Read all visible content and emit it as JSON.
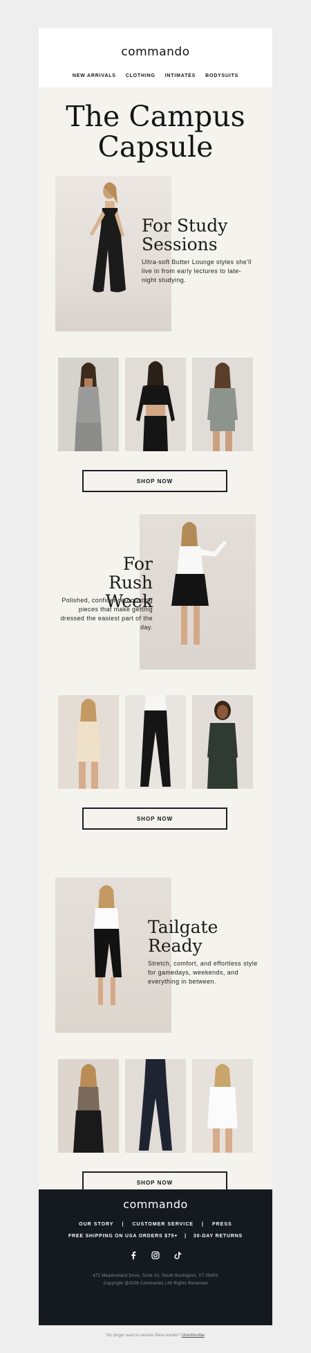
{
  "header": {
    "logo": "commando",
    "nav": [
      "NEW ARRIVALS",
      "CLOTHING",
      "INTIMATES",
      "BODYSUITS"
    ]
  },
  "hero_title_line1": "The Campus",
  "hero_title_line2": "Capsule",
  "sections": [
    {
      "title_line1": "For Study",
      "title_line2": "Sessions",
      "desc": "Ultra-soft Butter Lounge styles she'll live in from early lectures to late-night studying.",
      "button": "SHOP NOW"
    },
    {
      "title_line1": "For Rush",
      "title_line2": "Week",
      "desc": "Polished, confidence-boosting pieces that make getting dressed the easiest part of the day.",
      "button": "SHOP NOW"
    },
    {
      "title_line1": "Tailgate",
      "title_line2": "Ready",
      "desc": "Stretch, comfort, and effortless style for gamedays, weekends, and everything in between.",
      "button": "SHOP NOW"
    }
  ],
  "footer": {
    "logo": "commando",
    "links": [
      "OUR STORY",
      "|",
      "CUSTOMER SERVICE",
      "|",
      "PRESS"
    ],
    "shipping": [
      "FREE SHIPPING ON USA ORDERS $75+",
      "|",
      "30-DAY RETURNS"
    ],
    "social_icons": [
      "facebook-icon",
      "instagram-icon",
      "tiktok-icon"
    ],
    "address": "472 Meadowland Drive, Suite 10, South Burlington, VT 05403",
    "copyright": "Copyright @2026 Commando | All Rights Reserved"
  },
  "unsubscribe": {
    "text": "No longer want to receive these emails?",
    "link": "Unsubscribe"
  },
  "colors": {
    "background": "#eeeeee",
    "email_bg": "#f4f3ee",
    "footer_bg": "#141a1f",
    "button_border": "#1b1e24"
  }
}
